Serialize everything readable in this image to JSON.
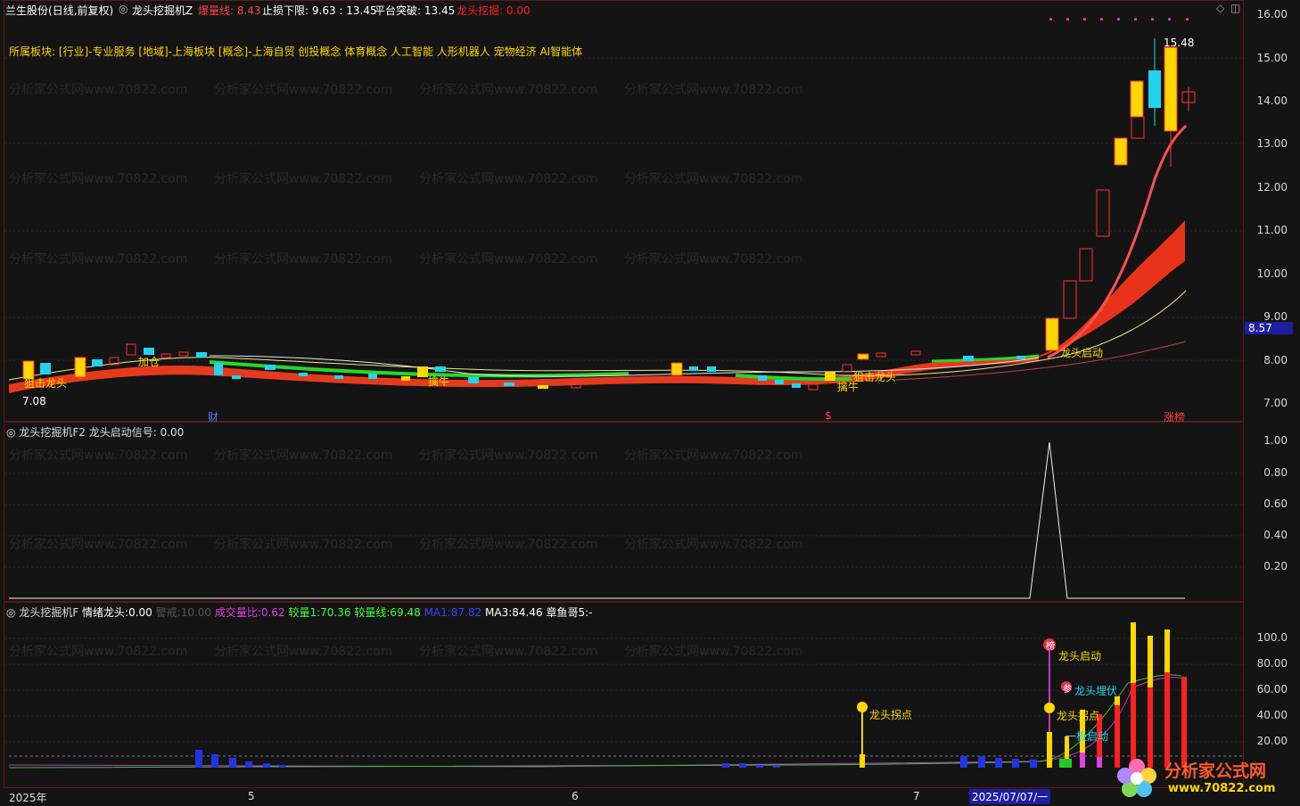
{
  "header": {
    "stock_name": "兰生股份",
    "period": "(日线,前复权)",
    "indicator": "龙头挖掘机Z",
    "items": [
      {
        "label": "爆量线:",
        "value": "8.43",
        "color": "#ff4040"
      },
      {
        "label": "止损下限:",
        "value": "9.63 : 13.45",
        "color": "#ffffff"
      },
      {
        "label": "平台突破:",
        "value": "13.45",
        "color": "#ffffff"
      },
      {
        "label": "龙头挖掘:",
        "value": "0.00",
        "color": "#ff2020"
      }
    ]
  },
  "sector_line": "所属板块: [行业]-专业服务 [地域]-上海板块 [概念]-上海自贸 创投概念 体育概念 人工智能 人形机器人 宠物经济 AI智能体",
  "watermark": "分析家公式网www.70822.com",
  "main_chart": {
    "y_ticks": [
      "16.00",
      "15.00",
      "14.00",
      "13.00",
      "12.00",
      "11.00",
      "10.00",
      "9.00",
      "8.00",
      "7.00"
    ],
    "current_price_tag": "8.57",
    "high_label": "15.48",
    "low_label": "7.08",
    "annotations": [
      "狙击龙头",
      "加仓",
      "擒牛",
      "擒牛",
      "狙击龙头",
      "龙头启动"
    ],
    "footer_marks": [
      "财",
      "$",
      "涨榜"
    ]
  },
  "panel2": {
    "title": "龙头挖掘机F2",
    "signal_label": "龙头启动信号:",
    "signal_value": "0.00",
    "y_ticks": [
      "1.00",
      "0.80",
      "0.60",
      "0.40",
      "0.20"
    ]
  },
  "panel3": {
    "title": "龙头挖掘机F",
    "items": [
      {
        "label": "情绪龙头:",
        "value": "0.00",
        "color": "#ffffff"
      },
      {
        "label": "警戒:",
        "value": "10.00",
        "color": "#555555"
      },
      {
        "label": "成交量比:",
        "value": "0.62",
        "color": "#e040e0"
      },
      {
        "label": "较量1:",
        "value": "70.36",
        "color": "#40ff40"
      },
      {
        "label": "较量线:",
        "value": "69.48",
        "color": "#40ff40"
      },
      {
        "label": "MA1:",
        "value": "87.82",
        "color": "#4040ff"
      },
      {
        "label": "MA3:",
        "value": "84.46",
        "color": "#ffffff"
      },
      {
        "label": "章鱼哥5:",
        "value": "-",
        "color": "#ffffff"
      }
    ],
    "y_ticks": [
      "100.0",
      "80.00",
      "60.00",
      "40.00",
      "20.00"
    ],
    "annotations": [
      "龙头拐点",
      "龙头启动",
      "龙头埋伏",
      "龙头拐点",
      "一板启动"
    ],
    "badges": [
      "榜",
      "参"
    ]
  },
  "x_axis": {
    "labels": [
      "2025年",
      "5",
      "6",
      "7",
      "2025/07/07/一"
    ]
  },
  "logo": {
    "text": "分析家公式网",
    "url": "www.70822.com"
  }
}
